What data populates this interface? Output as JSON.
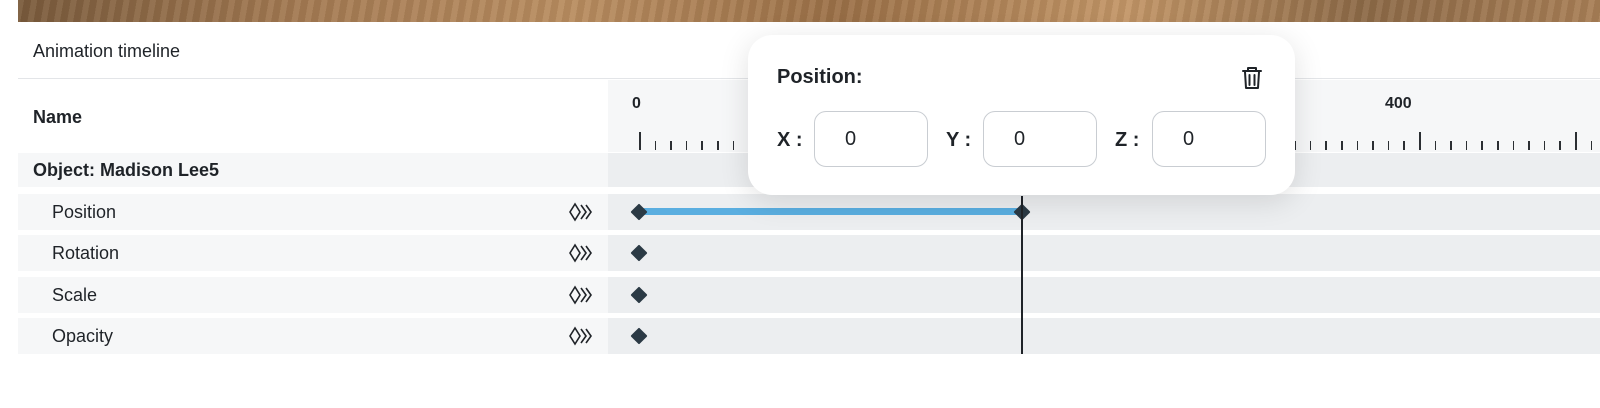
{
  "timeline": {
    "title": "Animation timeline",
    "name_header": "Name",
    "object_label": "Object:  Madison Lee5",
    "ruler_labels": [
      "0",
      "400"
    ],
    "properties": [
      {
        "label": "Position"
      },
      {
        "label": "Rotation"
      },
      {
        "label": "Scale"
      },
      {
        "label": "Opacity"
      }
    ],
    "colors": {
      "keyframe": "#2b3a45",
      "interpolation": "#5aaee0",
      "lane": "#eceef0"
    }
  },
  "popup": {
    "title": "Position:",
    "delete_icon": "trash-icon",
    "x_label": "X :",
    "y_label": "Y :",
    "z_label": "Z :",
    "x_value": "0",
    "y_value": "0",
    "z_value": "0"
  }
}
